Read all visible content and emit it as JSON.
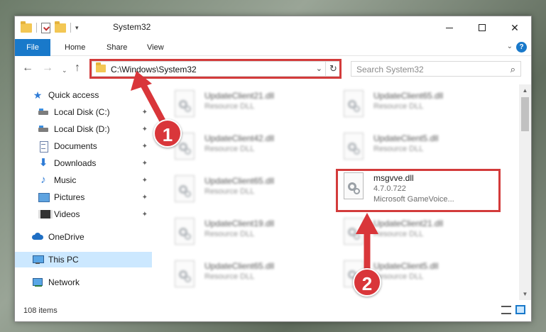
{
  "window": {
    "title": "System32",
    "controls": {
      "minimize": "—",
      "maximize": "",
      "close": "✕"
    }
  },
  "ribbon": {
    "tabs": [
      {
        "label": "File"
      },
      {
        "label": "Home"
      },
      {
        "label": "Share"
      },
      {
        "label": "View"
      }
    ],
    "help": "?"
  },
  "navbar": {
    "back": "←",
    "forward": "→",
    "recent": "⌄",
    "up": "↑",
    "address": "C:\\Windows\\System32",
    "address_dropdown": "⌄",
    "refresh": "↻",
    "search_placeholder": "Search System32",
    "search_icon": "⌕"
  },
  "sidebar": {
    "items": [
      {
        "label": "Quick access",
        "icon": "star-icon",
        "pinned": false
      },
      {
        "label": "Local Disk (C:)",
        "icon": "drive-icon",
        "pinned": true
      },
      {
        "label": "Local Disk (D:)",
        "icon": "drive-icon",
        "pinned": true
      },
      {
        "label": "Documents",
        "icon": "document-icon",
        "pinned": true
      },
      {
        "label": "Downloads",
        "icon": "download-icon",
        "pinned": true
      },
      {
        "label": "Music",
        "icon": "music-icon",
        "pinned": true
      },
      {
        "label": "Pictures",
        "icon": "pictures-icon",
        "pinned": true
      },
      {
        "label": "Videos",
        "icon": "videos-icon",
        "pinned": true
      },
      {
        "label": "OneDrive",
        "icon": "cloud-icon",
        "pinned": false
      },
      {
        "label": "This PC",
        "icon": "computer-icon",
        "pinned": false,
        "selected": true
      },
      {
        "label": "Network",
        "icon": "network-icon",
        "pinned": false
      }
    ],
    "pin_glyph": "📌"
  },
  "files": [
    {
      "name": "UpdateClient21.dll",
      "sub": "Resource DLL",
      "blurred": true
    },
    {
      "name": "UpdateClient65.dll",
      "sub": "Resource DLL",
      "blurred": true
    },
    {
      "name": "UpdateClient42.dll",
      "sub": "Resource DLL",
      "blurred": true
    },
    {
      "name": "UpdateClient5.dll",
      "sub": "Resource DLL",
      "blurred": true
    },
    {
      "name": "UpdateClient65.dll",
      "sub": "Resource DLL",
      "blurred": true
    },
    {
      "name": "msgvve.dll",
      "sub": "4.7.0.722",
      "sub2": "Microsoft GameVoice...",
      "blurred": false
    },
    {
      "name": "UpdateClient19.dll",
      "sub": "Resource DLL",
      "blurred": true
    },
    {
      "name": "UpdateClient21.dll",
      "sub": "Resource DLL",
      "blurred": true
    },
    {
      "name": "UpdateClient65.dll",
      "sub": "Resource DLL",
      "blurred": true
    },
    {
      "name": "UpdateClient5.dll",
      "sub": "Resource DLL",
      "blurred": true
    }
  ],
  "status": {
    "item_count": "108 items"
  },
  "callouts": [
    "1",
    "2"
  ],
  "colors": {
    "accent": "#1979ca",
    "highlight": "#d33b3b",
    "callout": "#d9363a",
    "selection": "#cce8ff"
  }
}
